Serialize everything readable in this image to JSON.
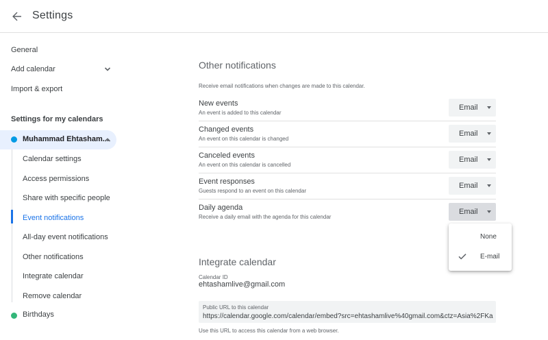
{
  "header": {
    "title": "Settings",
    "back_icon": "arrow-left-icon"
  },
  "sidebar": {
    "general": "General",
    "add_calendar": "Add calendar",
    "import_export": "Import & export",
    "section_title": "Settings for my calendars",
    "calendar_name": "Muhammad Ehtasham...",
    "calendar_color": "#039be5",
    "sub_items": [
      "Calendar settings",
      "Access permissions",
      "Share with specific people",
      "Event notifications",
      "All-day event notifications",
      "Other notifications",
      "Integrate calendar",
      "Remove calendar"
    ],
    "active_item": "Event notifications",
    "birthdays": "Birthdays",
    "birthdays_color": "#33b679"
  },
  "other_notifications": {
    "heading": "Other notifications",
    "description": "Receive email notifications when changes are made to this calendar.",
    "rows": [
      {
        "title": "New events",
        "subtitle": "An event is added to this calendar",
        "value": "Email"
      },
      {
        "title": "Changed events",
        "subtitle": "An event on this calendar is changed",
        "value": "Email"
      },
      {
        "title": "Canceled events",
        "subtitle": "An event on this calendar is cancelled",
        "value": "Email"
      },
      {
        "title": "Event responses",
        "subtitle": "Guests respond to an event on this calendar",
        "value": "Email"
      },
      {
        "title": "Daily agenda",
        "subtitle": "Receive a daily email with the agenda for this calendar",
        "value": "Email"
      }
    ]
  },
  "dropdown": {
    "options": [
      "None",
      "E-mail"
    ],
    "selected": "E-mail"
  },
  "integrate": {
    "heading": "Integrate calendar",
    "calendar_id_label": "Calendar ID",
    "calendar_id": "ehtashamlive@gmail.com",
    "public_url_label": "Public URL to this calendar",
    "public_url": "https://calendar.google.com/calendar/embed?src=ehtashamlive%40gmail.com&ctz=Asia%2FKa",
    "hint": "Use this URL to access this calendar from a web browser."
  },
  "colors": {
    "accent": "#1a73e8",
    "active_bg": "#e8f0fe"
  }
}
